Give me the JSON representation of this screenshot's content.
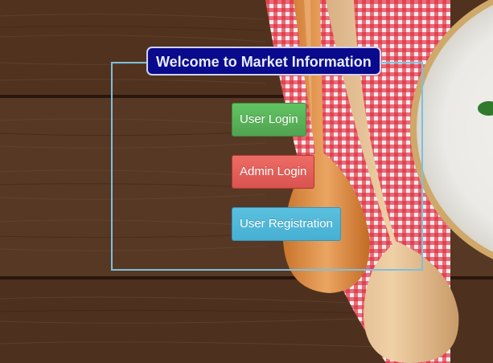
{
  "page": {
    "title": "Welcome to Market Information"
  },
  "buttons": {
    "user_login": "User Login",
    "admin_login": "Admin Login",
    "user_registration": "User Registration"
  },
  "colors": {
    "title_background": "#0a0a8c",
    "panel_border": "#7cc0de",
    "user_login": "#5cb85c",
    "admin_login": "#d9534f",
    "user_registration": "#5bc0de"
  }
}
